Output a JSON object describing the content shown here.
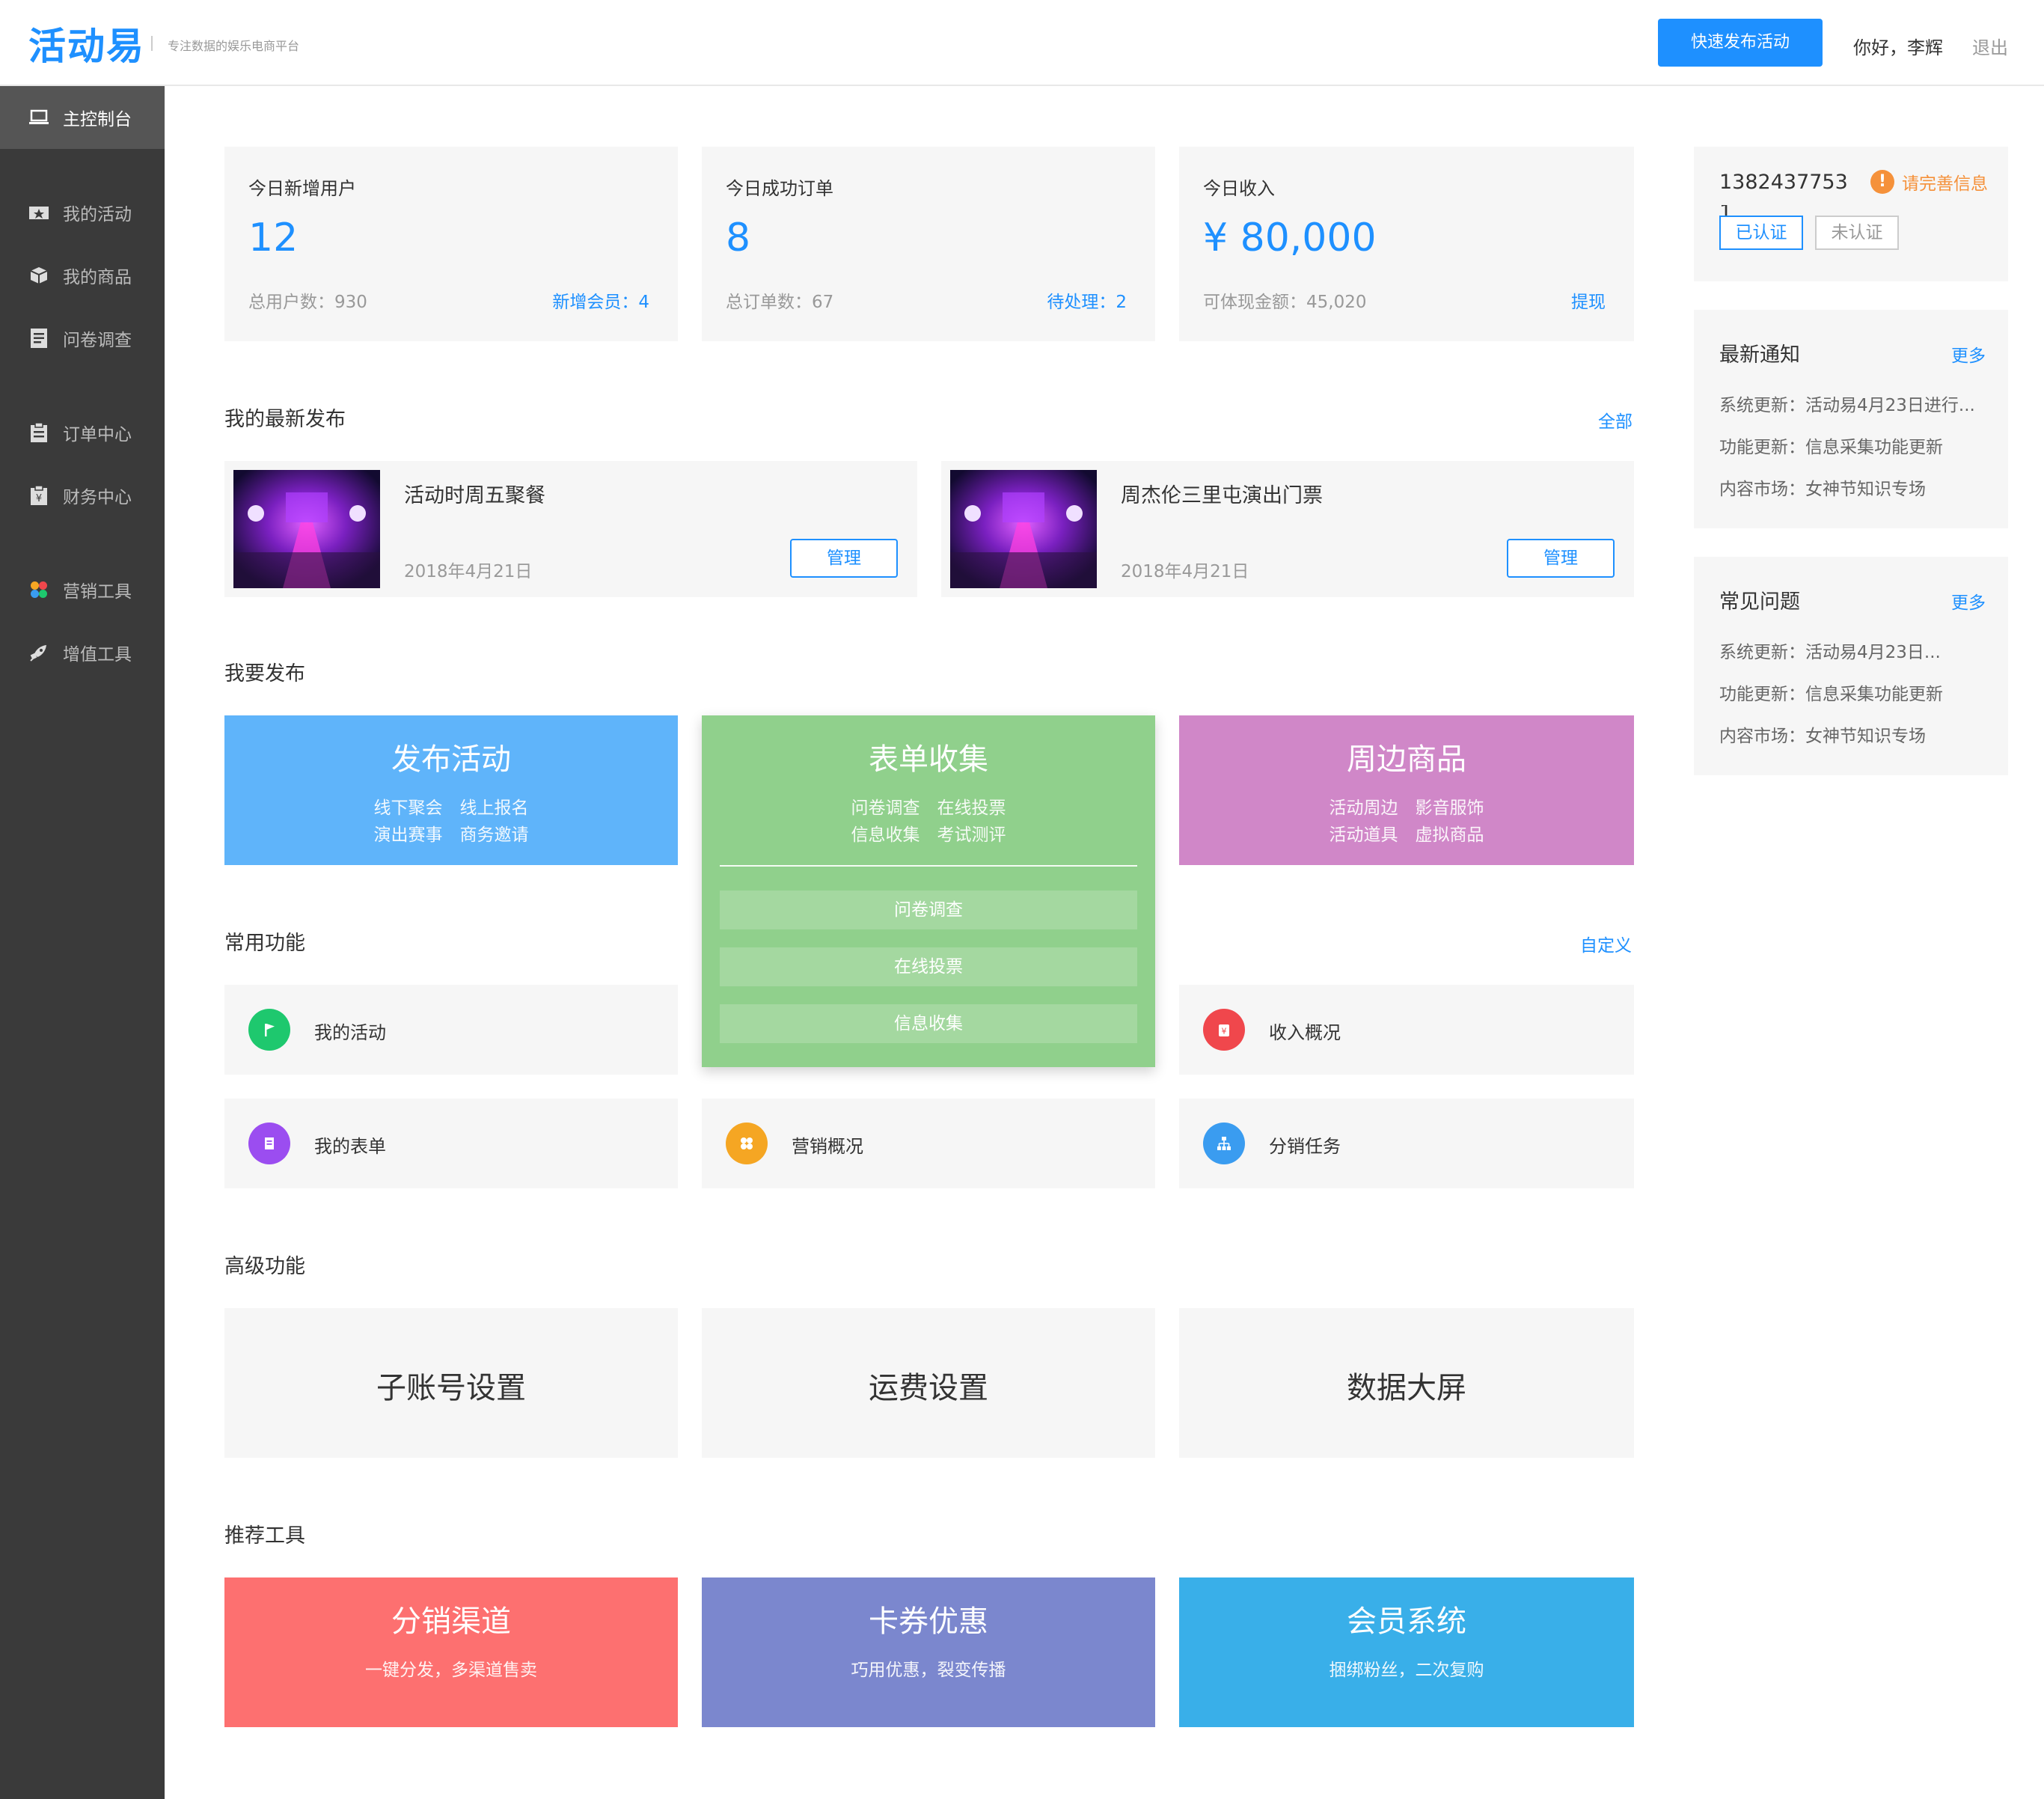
{
  "header": {
    "logo": "活动易",
    "tagline": "专注数据的娱乐电商平台",
    "quick_publish": "快速发布活动",
    "greeting": "你好，李辉",
    "logout": "退出"
  },
  "sidebar": {
    "items": [
      {
        "label": "主控制台",
        "icon": "console-icon"
      },
      {
        "label": "我的活动",
        "icon": "activity-icon"
      },
      {
        "label": "我的商品",
        "icon": "box-icon"
      },
      {
        "label": "问卷调查",
        "icon": "survey-icon"
      },
      {
        "label": "订单中心",
        "icon": "clipboard-icon"
      },
      {
        "label": "财务中心",
        "icon": "finance-icon"
      },
      {
        "label": "营销工具",
        "icon": "marketing-icon"
      },
      {
        "label": "增值工具",
        "icon": "rocket-icon"
      }
    ]
  },
  "stats": [
    {
      "title": "今日新增用户",
      "value": "12",
      "sub": "总用户数：930",
      "link": "新增会员：4"
    },
    {
      "title": "今日成功订单",
      "value": "8",
      "sub": "总订单数：67",
      "link": "待处理：2"
    },
    {
      "title": "今日收入",
      "value": "¥ 80,000",
      "sub": "可体现金额：45,020",
      "link": "提现"
    }
  ],
  "latest": {
    "title": "我的最新发布",
    "all": "全部",
    "items": [
      {
        "name": "活动时周五聚餐",
        "date": "2018年4月21日",
        "manage": "管理"
      },
      {
        "name": "周杰伦三里屯演出门票",
        "date": "2018年4月21日",
        "manage": "管理"
      }
    ]
  },
  "publish": {
    "title": "我要发布",
    "tiles": [
      {
        "title": "发布活动",
        "line1": "线下聚会　线上报名",
        "line2": "演出赛事　商务邀请",
        "color": "#5fb4fa"
      },
      {
        "title": "表单收集",
        "line1": "问卷调查　在线投票",
        "line2": "信息收集　考试测评",
        "color": "#90d08c",
        "options": [
          "问卷调查",
          "在线投票",
          "信息收集"
        ]
      },
      {
        "title": "周边商品",
        "line1": "活动周边　影音服饰",
        "line2": "活动道具　虚拟商品",
        "color": "#d087c8"
      }
    ]
  },
  "common": {
    "title": "常用功能",
    "customize": "自定义",
    "items": [
      {
        "label": "我的活动",
        "icon": "flag-icon",
        "color": "#1ec86e"
      },
      {
        "label": "收入概况",
        "icon": "money-bag-icon",
        "color": "#f0474c"
      },
      {
        "label": "我的表单",
        "icon": "form-icon",
        "color": "#9b4df0"
      },
      {
        "label": "营销概况",
        "icon": "clover-icon",
        "color": "#f5a623"
      },
      {
        "label": "分销任务",
        "icon": "hierarchy-icon",
        "color": "#3a9cf0"
      }
    ]
  },
  "advanced": {
    "title": "高级功能",
    "items": [
      "子账号设置",
      "运费设置",
      "数据大屏"
    ]
  },
  "recommend": {
    "title": "推荐工具",
    "tiles": [
      {
        "title": "分销渠道",
        "sub": "一键分发，多渠道售卖",
        "color": "#fd7070"
      },
      {
        "title": "卡券优惠",
        "sub": "巧用优惠，裂变传播",
        "color": "#7b87ce"
      },
      {
        "title": "会员系统",
        "sub": "捆绑粉丝，二次复购",
        "color": "#39afe9"
      }
    ]
  },
  "account": {
    "phone_line1": "1382437753",
    "phone_line2": "1",
    "warning": "请完善信息",
    "verified": "已认证",
    "unverified": "未认证"
  },
  "notices": {
    "title": "最新通知",
    "more": "更多",
    "lines": [
      "系统更新：活动易4月23日进行...",
      "功能更新：信息采集功能更新",
      "内容市场：女神节知识专场"
    ]
  },
  "faq": {
    "title": "常见问题",
    "more": "更多",
    "lines": [
      "系统更新：活动易4月23日...",
      "功能更新：信息采集功能更新",
      "内容市场：女神节知识专场"
    ]
  }
}
